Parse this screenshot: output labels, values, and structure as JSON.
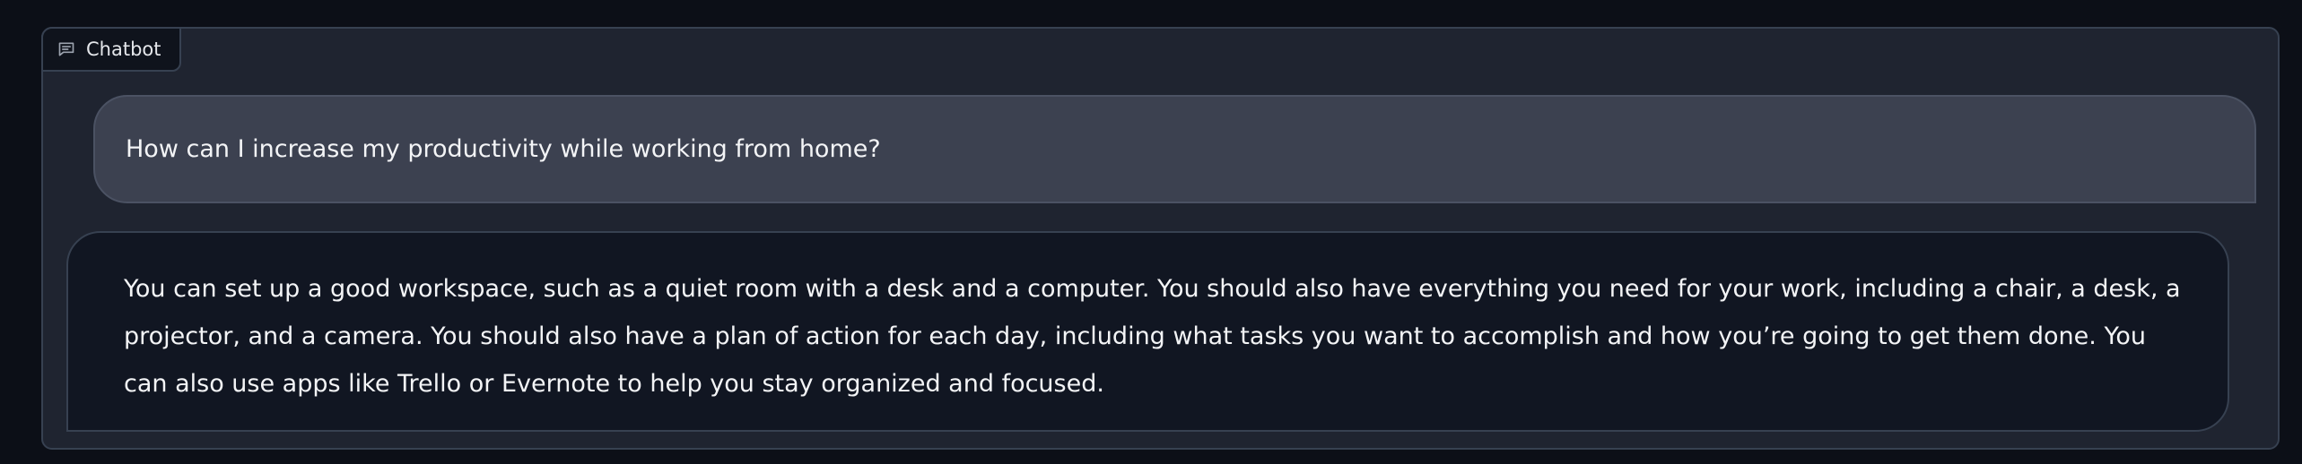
{
  "chatbot": {
    "label": "Chatbot",
    "icon": "chat-icon",
    "messages": [
      {
        "role": "user",
        "text": "How can I increase my productivity while working from home?"
      },
      {
        "role": "bot",
        "text": "You can set up a good workspace, such as a quiet room with a desk and a computer. You should also have everything you need for your work, including a chair, a desk, a projector, and a camera. You should also have a plan of action for each day, including what tasks you want to accomplish and how you’re going to get them done. You can also use apps like Trello or Evernote to help you stay organized and focused."
      }
    ]
  },
  "colors": {
    "page_bg": "#0c0f17",
    "panel_bg": "#1f2430",
    "user_bubble": "#3c4150",
    "bot_bubble": "#111622",
    "text": "#f3f4f6"
  }
}
